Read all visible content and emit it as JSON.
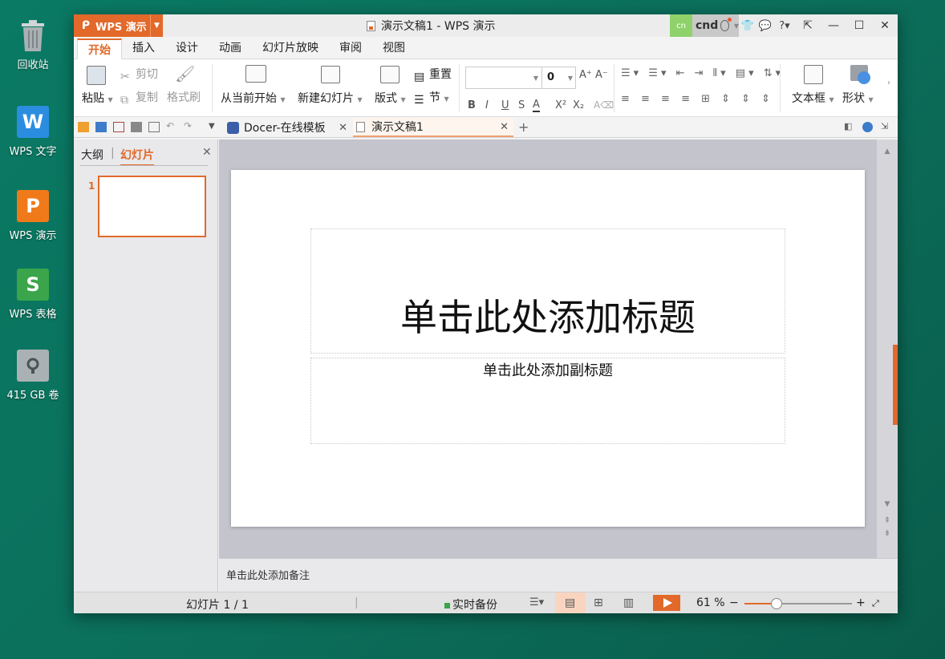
{
  "desktop": {
    "icons": [
      {
        "label": "回收站",
        "icon": "trash-icon"
      },
      {
        "label": "WPS 文字",
        "icon": "wps-writer-icon",
        "glyph": "W",
        "color": "#2b8de0"
      },
      {
        "label": "WPS 演示",
        "icon": "wps-presentation-icon",
        "glyph": "P",
        "color": "#f07a1a"
      },
      {
        "label": "WPS 表格",
        "icon": "wps-spreadsheet-icon",
        "glyph": "S",
        "color": "#3aa54a"
      },
      {
        "label": "415 GB 卷",
        "icon": "disk-volume-icon"
      }
    ]
  },
  "window": {
    "app_button": "WPS 演示",
    "title": "演示文稿1 - WPS 演示",
    "lang_badge": "cn",
    "user": "cnd",
    "accent": "#e2692a"
  },
  "menu": {
    "tabs": [
      "开始",
      "插入",
      "设计",
      "动画",
      "幻灯片放映",
      "审阅",
      "视图"
    ],
    "active": 0
  },
  "ribbon": {
    "paste": "粘贴",
    "cut": "剪切",
    "copy": "复制",
    "format_painter": "格式刷",
    "from_current": "从当前开始",
    "new_slide": "新建幻灯片",
    "layout": "版式",
    "reset": "重置",
    "section": "节",
    "font_size": "0",
    "text_box": "文本框",
    "shape": "形状"
  },
  "doc_tabs": [
    {
      "label": "Docer-在线模板",
      "active": false
    },
    {
      "label": "演示文稿1",
      "active": true
    }
  ],
  "left_pane": {
    "tab_outline": "大纲",
    "tab_slides": "幻灯片",
    "slide_number": "1"
  },
  "slide": {
    "title_placeholder": "单击此处添加标题",
    "subtitle_placeholder": "单击此处添加副标题"
  },
  "notes_placeholder": "单击此处添加备注",
  "status": {
    "slide_info": "幻灯片 1 / 1",
    "backup": "实时备份",
    "zoom": "61 %",
    "zoom_fraction": 0.3
  }
}
